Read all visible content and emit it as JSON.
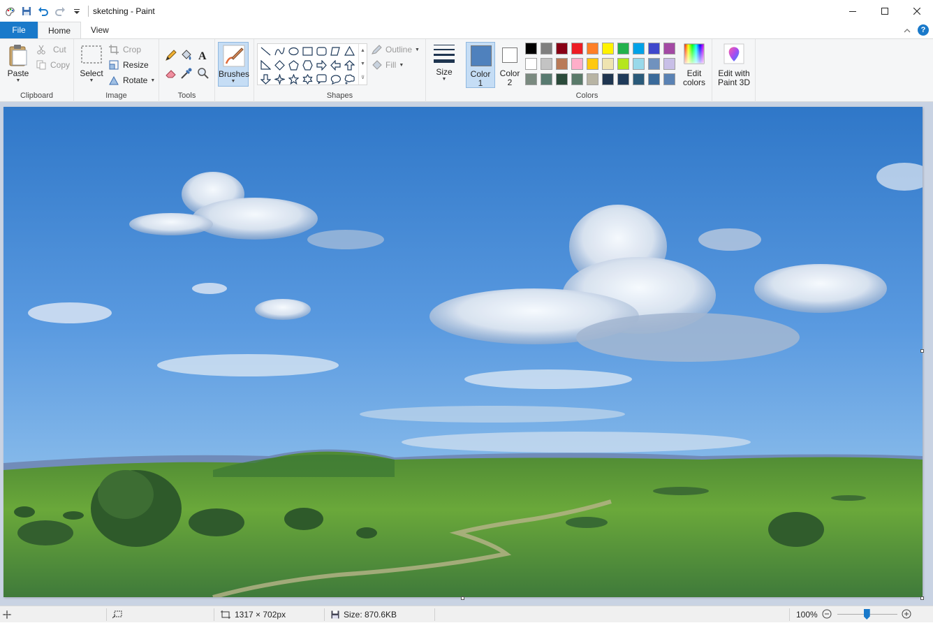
{
  "window": {
    "title": "sketching - Paint"
  },
  "tabs": {
    "file": "File",
    "home": "Home",
    "view": "View"
  },
  "ribbon": {
    "clipboard": {
      "label": "Clipboard",
      "paste": "Paste",
      "cut": "Cut",
      "copy": "Copy"
    },
    "image": {
      "label": "Image",
      "select": "Select",
      "crop": "Crop",
      "resize": "Resize",
      "rotate": "Rotate"
    },
    "tools": {
      "label": "Tools"
    },
    "brushes": {
      "label": "Brushes"
    },
    "shapes": {
      "label": "Shapes",
      "outline": "Outline",
      "fill": "Fill",
      "items": [
        "line",
        "curve",
        "oval",
        "rectangle",
        "rounded-rectangle",
        "polygon",
        "triangle",
        "right-triangle",
        "diamond",
        "pentagon",
        "hexagon",
        "right-arrow",
        "left-arrow",
        "up-arrow",
        "down-arrow",
        "four-point-star",
        "five-point-star",
        "six-point-star",
        "rounded-callout",
        "oval-callout",
        "cloud-callout"
      ]
    },
    "size": {
      "label": "Size"
    },
    "colors": {
      "label": "Colors",
      "color1_line1": "Color",
      "color1_line2": "1",
      "color2_line1": "Color",
      "color2_line2": "2",
      "color1_value": "#4f81bd",
      "color2_value": "#ffffff",
      "edit_line1": "Edit",
      "edit_line2": "colors",
      "palette": [
        "#000000",
        "#7f7f7f",
        "#880015",
        "#ed1c24",
        "#ff7f27",
        "#fff200",
        "#22b14c",
        "#00a2e8",
        "#3f48cc",
        "#a349a4",
        "#ffffff",
        "#c3c3c3",
        "#b97a57",
        "#ffaec9",
        "#ffc90e",
        "#efe4b0",
        "#b5e61d",
        "#99d9ea",
        "#7092be",
        "#c8bfe7",
        "#7a8a80",
        "#587a70",
        "#2a4a3a",
        "#5a7a6a",
        "#b8b4a4",
        "#1f3550",
        "#1f3a5a",
        "#2a5a7a",
        "#3a6a9a",
        "#5a82b4"
      ]
    },
    "paint3d": {
      "line1": "Edit with",
      "line2": "Paint 3D"
    }
  },
  "status": {
    "dimensions": "1317 × 702px",
    "size": "Size: 870.6KB",
    "zoom": "100%"
  },
  "accent": "#1979ca"
}
